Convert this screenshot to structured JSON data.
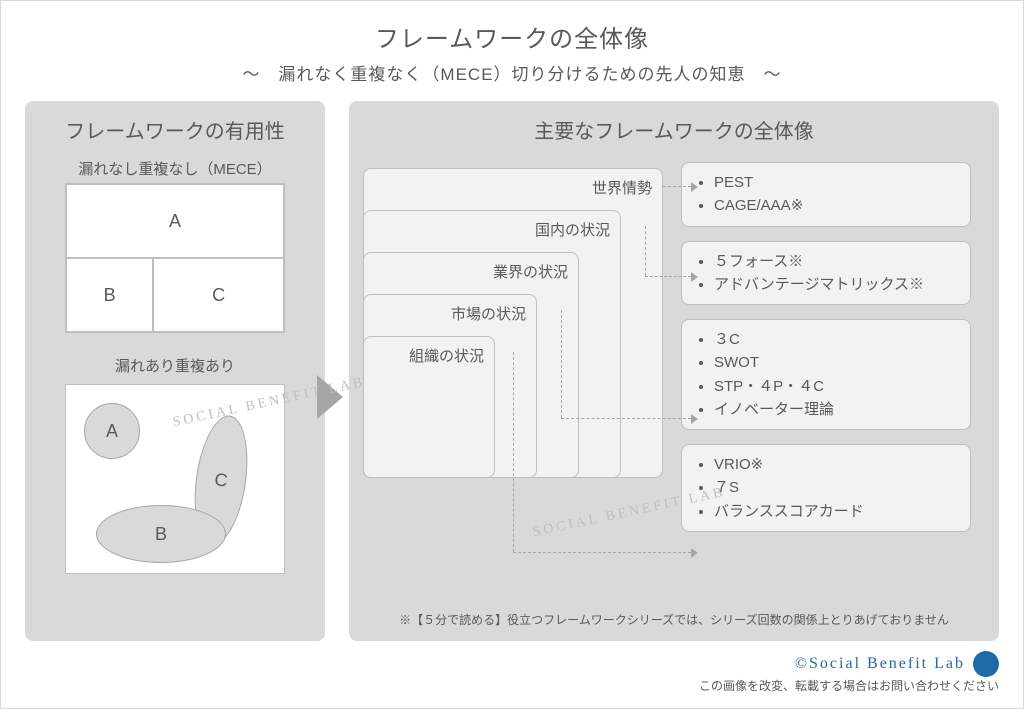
{
  "title": "フレームワークの全体像",
  "subtitle": "〜　漏れなく重複なく（MECE）切り分けるための先人の知恵　〜",
  "left_panel": {
    "title": "フレームワークの有用性",
    "mece_label": "漏れなし重複なし（MECE）",
    "cells": {
      "a": "A",
      "b": "B",
      "c": "C"
    },
    "nonmece_label": "漏れあり重複あり",
    "blobs": {
      "a": "A",
      "b": "B",
      "c": "C"
    }
  },
  "right_panel": {
    "title": "主要なフレームワークの全体像",
    "nests": [
      "世界情勢",
      "国内の状況",
      "業界の状況",
      "市場の状況",
      "組織の状況"
    ],
    "boxes": [
      {
        "items": [
          "PEST",
          "CAGE/AAA※"
        ]
      },
      {
        "items": [
          "５フォース※",
          "アドバンテージマトリックス※"
        ]
      },
      {
        "items": [
          "３C",
          "SWOT",
          "STP・４P・４C",
          "イノベーター理論"
        ]
      },
      {
        "items": [
          "VRIO※",
          "７S",
          "バランススコアカード"
        ]
      }
    ],
    "note": "※【５分で読める】役立つフレームワークシリーズでは、シリーズ回数の関係上とりあげておりません"
  },
  "credit": {
    "lab": "©Social Benefit Lab",
    "sub": "この画像を改変、転載する場合はお問い合わせください"
  },
  "watermark": "SOCIAL BENEFIT LAB"
}
